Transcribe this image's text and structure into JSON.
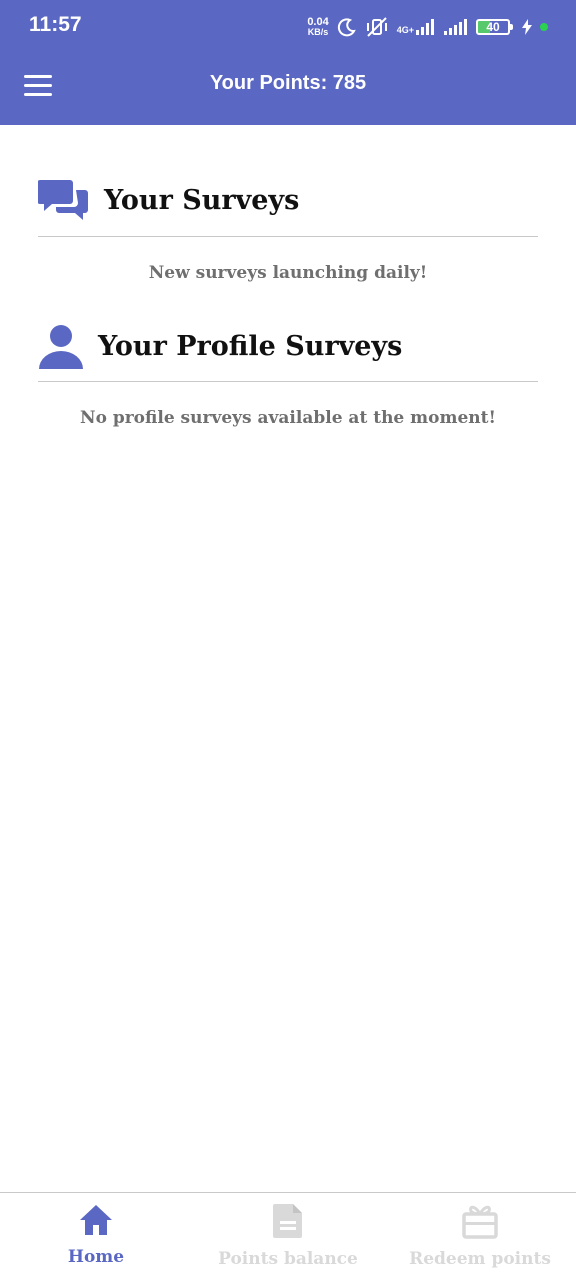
{
  "status_bar": {
    "time": "11:57",
    "net_speed_value": "0.04",
    "net_speed_unit": "KB/s",
    "network_tag": "4G+",
    "battery": "40"
  },
  "header": {
    "points_title": "Your Points: 785"
  },
  "sections": {
    "surveys": {
      "title": "Your Surveys",
      "message": "New surveys launching daily!",
      "icon": "chat-bubbles-icon"
    },
    "profile_surveys": {
      "title": "Your Profile Surveys",
      "message": "No profile surveys available at the moment!",
      "icon": "user-icon"
    }
  },
  "bottom_nav": {
    "items": [
      {
        "label": "Home",
        "icon": "home-icon",
        "active": true
      },
      {
        "label": "Points balance",
        "icon": "document-icon",
        "active": false
      },
      {
        "label": "Redeem points",
        "icon": "gift-icon",
        "active": false
      }
    ]
  },
  "colors": {
    "primary": "#5b68c3",
    "inactive": "#d9d9d9",
    "message_text": "#6f6f6f"
  }
}
